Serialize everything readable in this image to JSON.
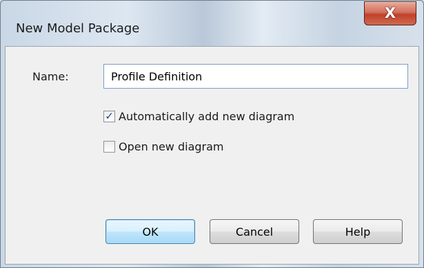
{
  "window": {
    "title": "New Model Package"
  },
  "title_bar": {
    "close_icon": "close-icon",
    "close_glyph": "X"
  },
  "form": {
    "name_label": "Name:",
    "name_value": "Profile Definition",
    "checkboxes": [
      {
        "label": "Automatically add new diagram",
        "checked": true
      },
      {
        "label": "Open new diagram",
        "checked": false
      }
    ]
  },
  "buttons": {
    "ok": "OK",
    "cancel": "Cancel",
    "help": "Help"
  },
  "colors": {
    "close_button": "#c94b33",
    "default_button_border": "#3c7fb1",
    "check_mark": "#243d8c"
  }
}
